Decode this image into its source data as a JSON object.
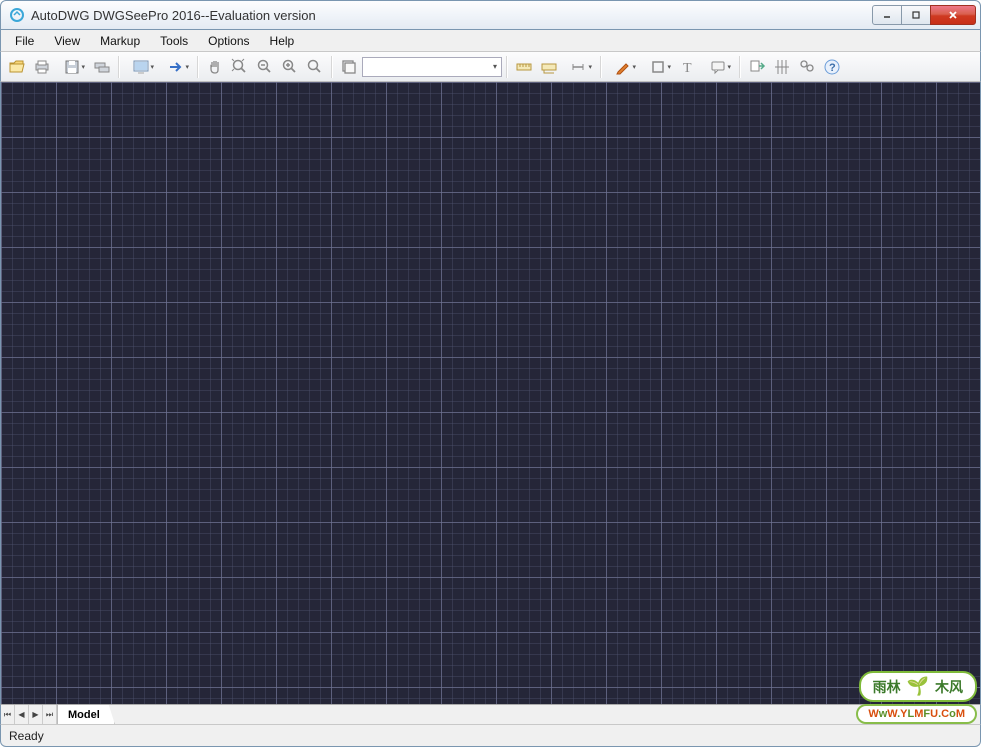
{
  "titlebar": {
    "title": "AutoDWG DWGSeePro 2016--Evaluation version"
  },
  "menu": {
    "items": [
      "File",
      "View",
      "Markup",
      "Tools",
      "Options",
      "Help"
    ]
  },
  "toolbar": {
    "combo_value": ""
  },
  "tabstrip": {
    "tab": "Model"
  },
  "statusbar": {
    "status": "Ready"
  },
  "watermark": {
    "top_left": "雨林",
    "top_right": "木风",
    "url": "WwW.YLMFU.CoM"
  }
}
